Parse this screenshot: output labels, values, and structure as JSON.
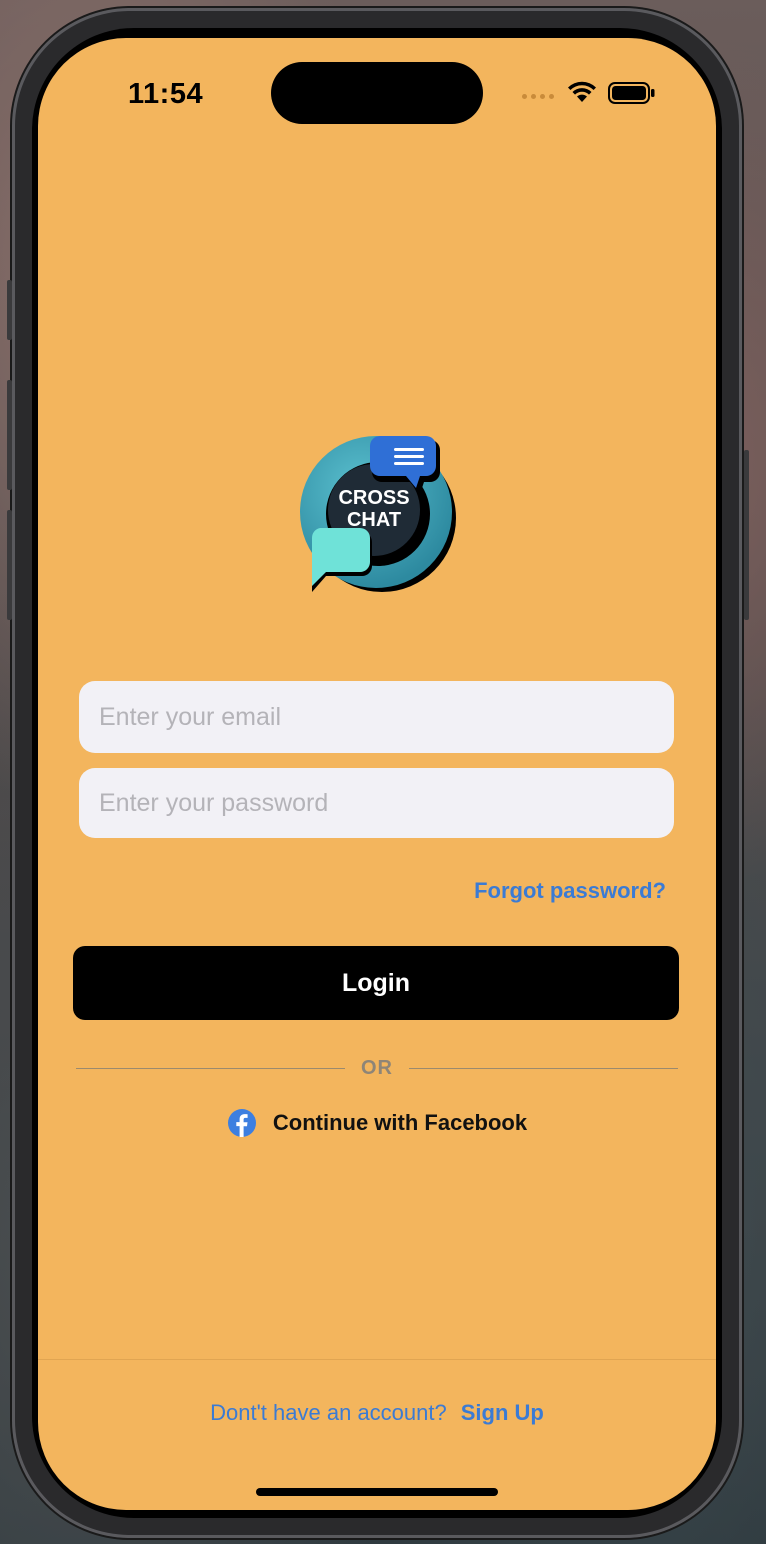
{
  "status_bar": {
    "time": "11:54"
  },
  "app": {
    "logo_text_line1": "CROSS",
    "logo_text_line2": "CHAT",
    "accent": "#3b7bd4",
    "background": "#f3b55d"
  },
  "form": {
    "email_placeholder": "Enter your email",
    "password_placeholder": "Enter your password",
    "forgot_label": "Forgot password?",
    "login_label": "Login",
    "divider_label": "OR",
    "facebook_label": "Continue with Facebook"
  },
  "footer": {
    "prompt": "Dont't have an account?",
    "signup_label": "Sign Up"
  },
  "icons": {
    "wifi": "wifi-icon",
    "battery": "battery-icon",
    "facebook": "facebook-icon"
  }
}
